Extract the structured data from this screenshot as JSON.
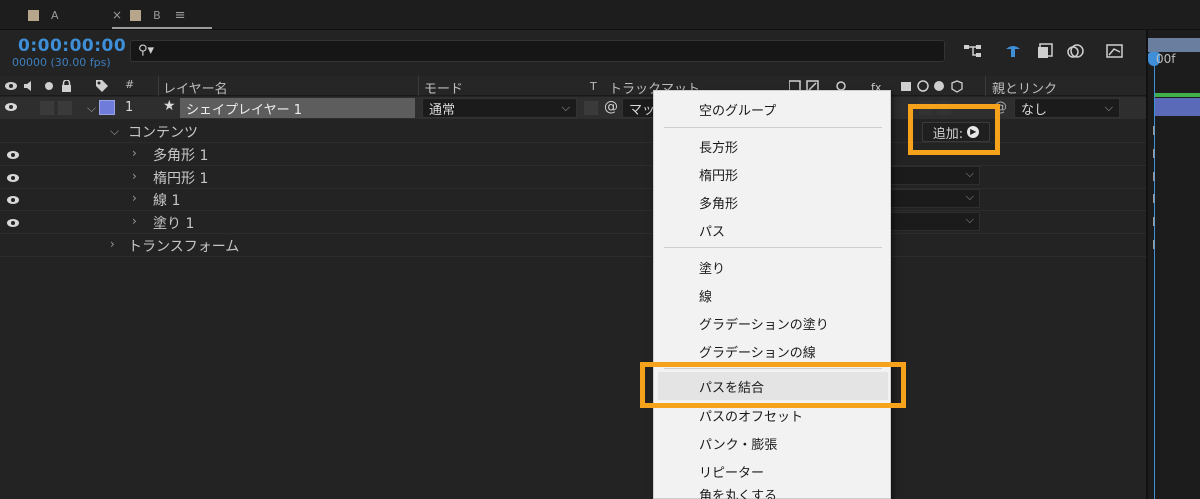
{
  "tabs": [
    {
      "label": "A",
      "close": ""
    },
    {
      "label": "B",
      "close": "×"
    }
  ],
  "tab_menu_icon": "≡",
  "timecode": "0:00:00:00",
  "fps": "00000 (30.00 fps)",
  "search": {
    "value": "",
    "placeholder": ""
  },
  "columns": {
    "index": "#",
    "layer_name": "レイヤー名",
    "mode": "モード",
    "t": "T",
    "track_matte": "トラックマット",
    "parent_link": "親とリンク"
  },
  "layer": {
    "number": "1",
    "name": "シェイプレイヤー 1",
    "mode": "通常",
    "matte": "マッ",
    "parent": "なし"
  },
  "tree": {
    "contents": "コンテンツ",
    "items": [
      "多角形 1",
      "楕円形 1",
      "線 1",
      "塗り 1"
    ],
    "transform": "トランスフォーム"
  },
  "add_button": {
    "label": "追加:"
  },
  "timeline": {
    "frame_label": "00f"
  },
  "menu": {
    "group1": [
      "空のグループ"
    ],
    "group2": [
      "長方形",
      "楕円形",
      "多角形",
      "パス"
    ],
    "group3": [
      "塗り",
      "線",
      "グラデーションの塗り",
      "グラデーションの線"
    ],
    "group4": [
      "パスを結合",
      "パスのオフセット",
      "パンク・膨張",
      "リピーター",
      "角を丸くする"
    ]
  },
  "highlight_color": "#f7a21b",
  "accent_color": "#3e8ed8"
}
